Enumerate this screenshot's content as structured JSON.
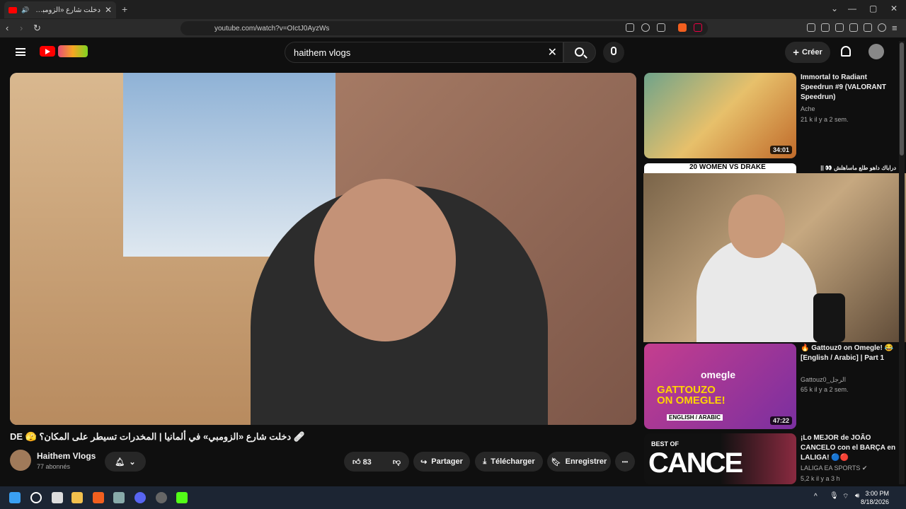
{
  "browser": {
    "tab_title": "دخلت شارع «الزومبي» في ألمانيا",
    "url": "youtube.com/watch?v=OIctJ0AyzWs",
    "new_tab": "+",
    "close": "✕"
  },
  "header": {
    "search_value": "haithem vlogs",
    "create_label": "Créer",
    "clear": "✕"
  },
  "video": {
    "title": "DE 🫣 دخلت شارع «الزومبي» في ألمانيا | المخدرات تسيطر على المكان؟ 🩹",
    "channel": "Haithem Vlogs",
    "subscribers": "77 abonnés",
    "likes": "83",
    "share": "Partager",
    "download": "Télécharger",
    "save": "Enregistrer",
    "more": "•••"
  },
  "sidebar": [
    {
      "title": "Immortal to Radiant Speedrun #9 (VALORANT Speedrun)",
      "channel": "Ache",
      "meta": "21 k  il y a 2 sem.",
      "duration": "34:01"
    },
    {
      "title": "دراباك داهو طلع ماساهلش 👀 ||",
      "banner": "20 WOMEN VS DRAKE"
    },
    {
      "title": "🔥 Gattouz0 on Omegle! 😂 [English / Arabic] | Part 1",
      "channel": "Gattouz0_الرجل",
      "meta": "65 k  il y a 2 sem.",
      "duration": "47:22",
      "thumb_text": "GATTOUZO ON OMEGLE!",
      "thumb_sub": "ENGLISH / ARABIC",
      "thumb_logo": "omegle"
    },
    {
      "title": "¡Lo MEJOR de JOÃO CANCELO con el BARÇA en LALIGA! 🔵🔴",
      "channel": "LALIGA EA SPORTS ✔",
      "meta": "5,2 k  il y a 3 h",
      "thumb_text": "BEST OF",
      "thumb_big": "CANCE"
    }
  ],
  "taskbar": {
    "time": "3:00 PM",
    "date": "8/18/2026"
  },
  "colors": {
    "yt_red": "#ff0000",
    "bg": "#0f0f0f",
    "pill": "#272727"
  }
}
